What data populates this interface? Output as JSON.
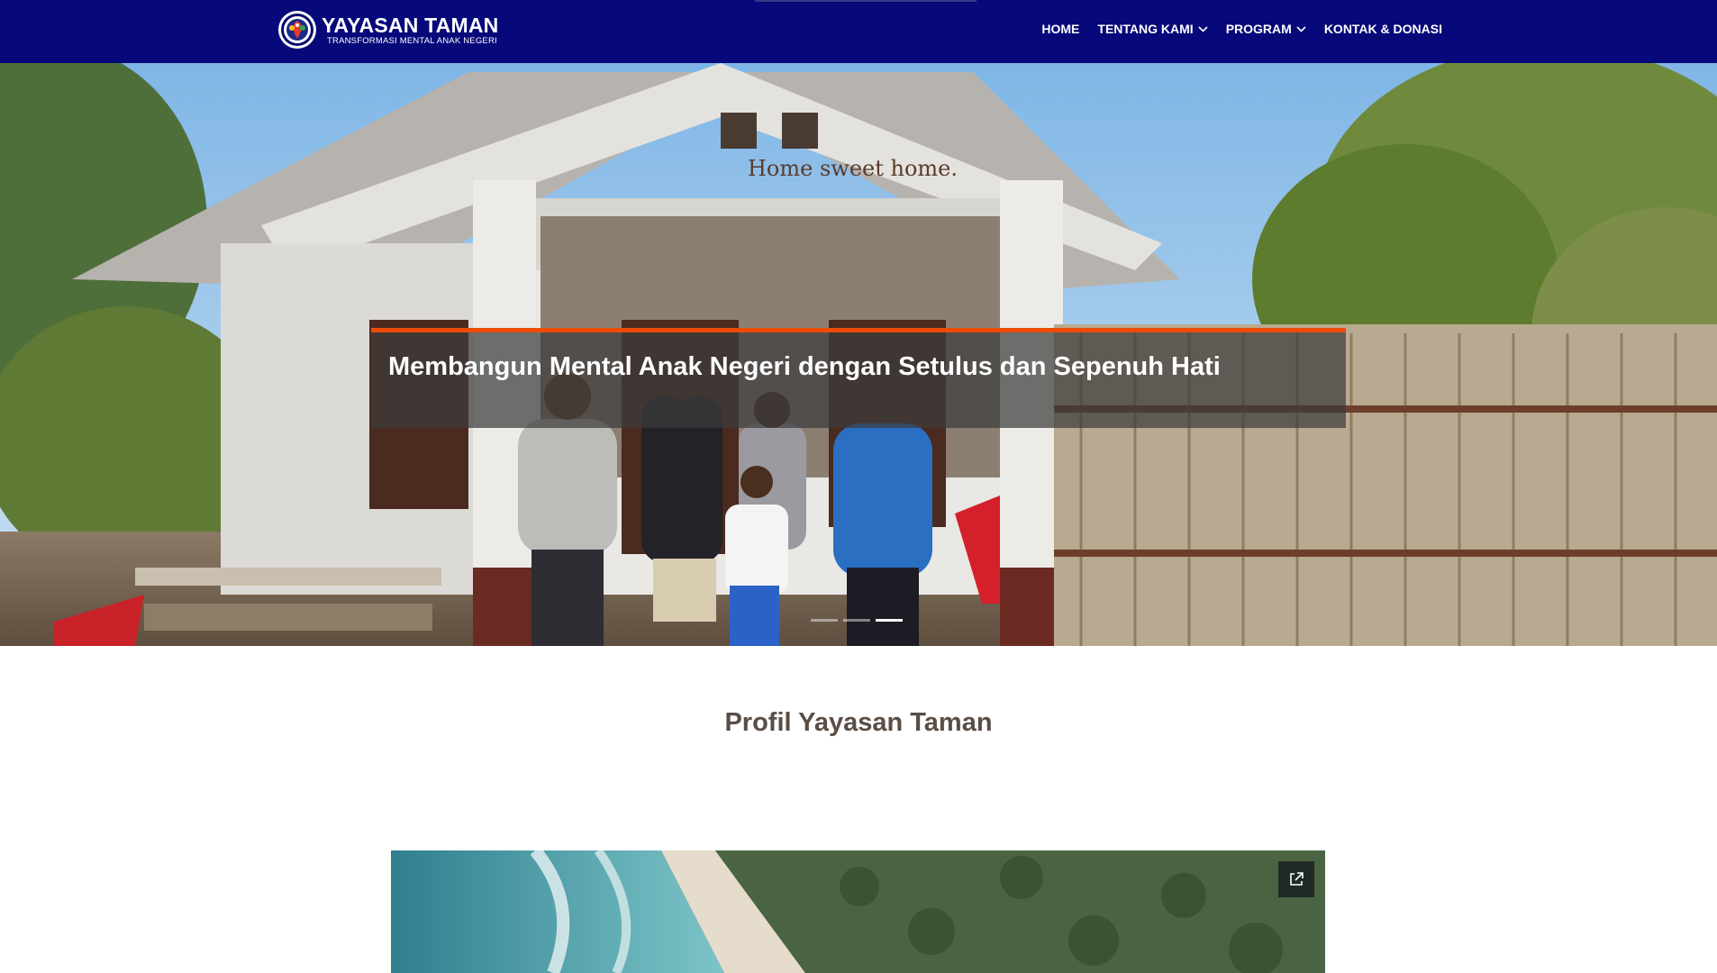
{
  "brand": {
    "name": "YAYASAN TAMAN",
    "tagline": "TRANSFORMASI MENTAL ANAK NEGERI"
  },
  "nav": {
    "items": [
      {
        "label": "HOME",
        "has_dropdown": false
      },
      {
        "label": "TENTANG KAMI",
        "has_dropdown": true
      },
      {
        "label": "PROGRAM",
        "has_dropdown": true
      },
      {
        "label": "KONTAK & DONASI",
        "has_dropdown": false
      }
    ]
  },
  "hero": {
    "caption": "Membangun Mental Anak Negeri dengan Setulus dan Sepenuh Hati",
    "sign_text": "Home sweet home.",
    "slide_count": 3,
    "active_slide": 3
  },
  "profile": {
    "title": "Profil Yayasan Taman",
    "video_icon": "external-link-icon"
  },
  "colors": {
    "nav_bg": "#07087a",
    "accent": "#ee4b08",
    "heading": "#5a4d45"
  }
}
